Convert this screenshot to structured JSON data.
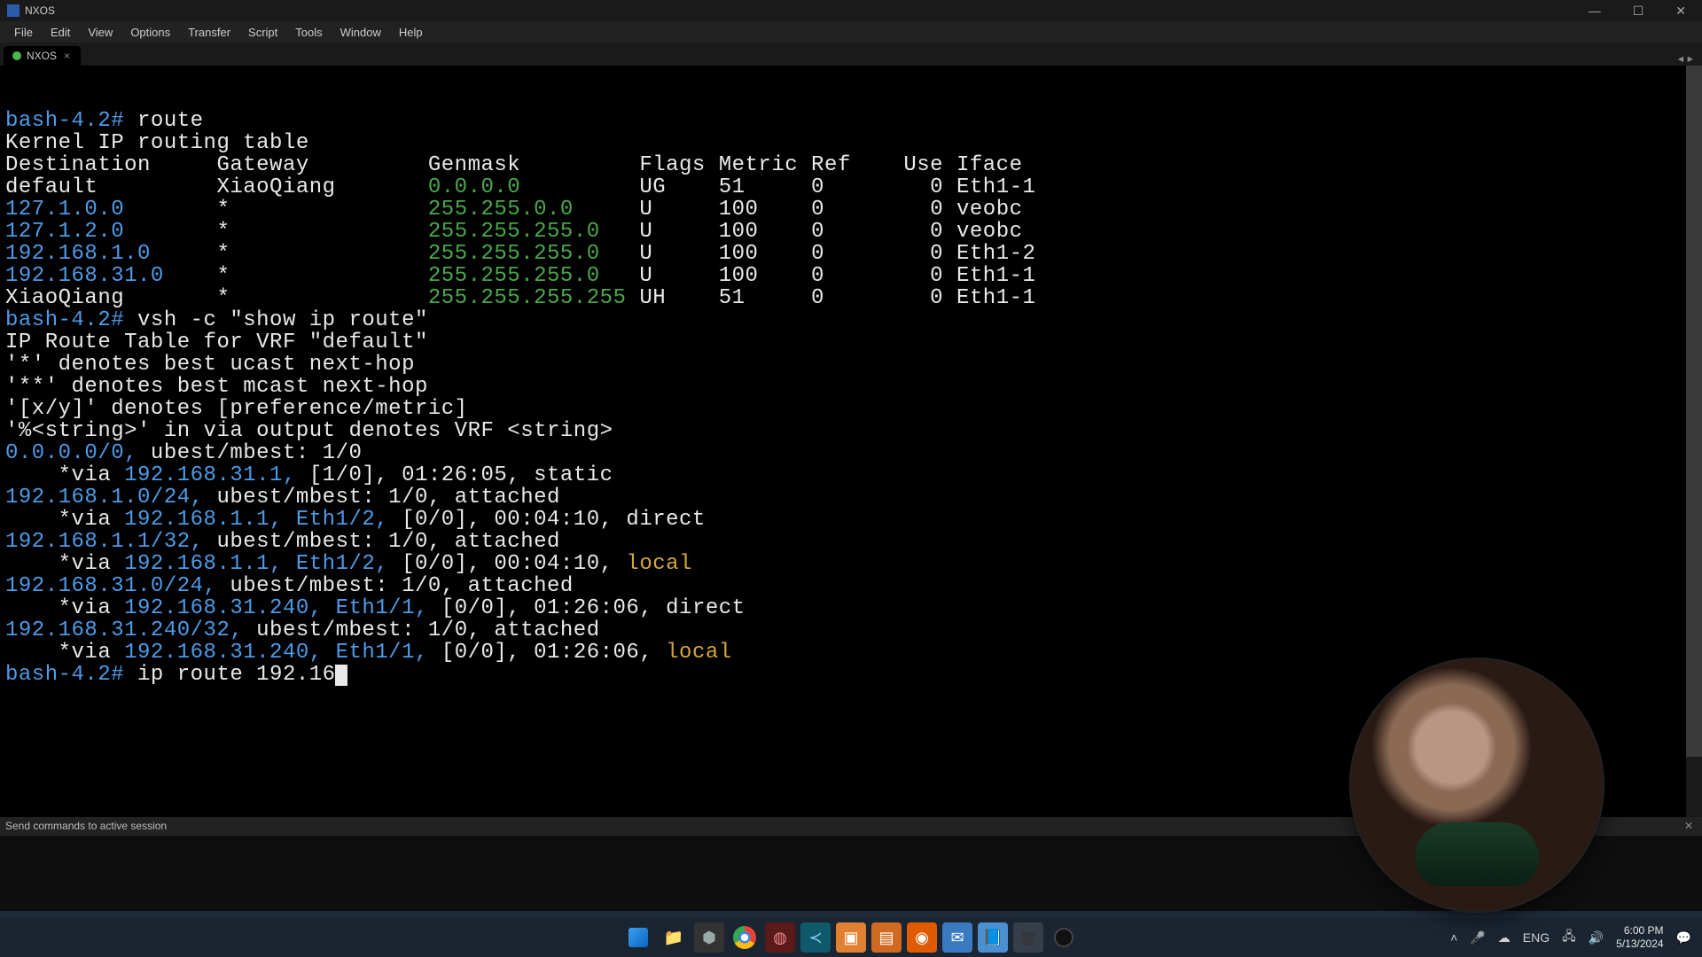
{
  "window": {
    "title": "NXOS"
  },
  "menubar": [
    "File",
    "Edit",
    "View",
    "Options",
    "Transfer",
    "Script",
    "Tools",
    "Window",
    "Help"
  ],
  "tab": {
    "label": "NXOS"
  },
  "status": {
    "text": "Send commands to active session"
  },
  "taskbar": {
    "lang": "ENG",
    "time": "6:00 PM",
    "date": "5/13/2024"
  },
  "terminal": {
    "lines": [
      {
        "segs": [
          {
            "c": "blue",
            "t": "bash-4.2#"
          },
          {
            "c": "white",
            "t": " route"
          }
        ]
      },
      {
        "segs": [
          {
            "c": "white",
            "t": "Kernel IP routing table"
          }
        ]
      },
      {
        "segs": [
          {
            "c": "white",
            "t": "Destination     Gateway         Genmask         Flags Metric Ref    Use Iface"
          }
        ]
      },
      {
        "segs": [
          {
            "c": "white",
            "t": "default         XiaoQiang       "
          },
          {
            "c": "green",
            "t": "0.0.0.0"
          },
          {
            "c": "white",
            "t": "         UG    51     0        0 Eth1-1"
          }
        ]
      },
      {
        "segs": [
          {
            "c": "blue",
            "t": "127.1.0.0"
          },
          {
            "c": "white",
            "t": "       *               "
          },
          {
            "c": "green",
            "t": "255.255.0.0"
          },
          {
            "c": "white",
            "t": "     U     100    0        0 veobc"
          }
        ]
      },
      {
        "segs": [
          {
            "c": "blue",
            "t": "127.1.2.0"
          },
          {
            "c": "white",
            "t": "       *               "
          },
          {
            "c": "green",
            "t": "255.255.255.0"
          },
          {
            "c": "white",
            "t": "   U     100    0        0 veobc"
          }
        ]
      },
      {
        "segs": [
          {
            "c": "blue",
            "t": "192.168.1.0"
          },
          {
            "c": "white",
            "t": "     *               "
          },
          {
            "c": "green",
            "t": "255.255.255.0"
          },
          {
            "c": "white",
            "t": "   U     100    0        0 Eth1-2"
          }
        ]
      },
      {
        "segs": [
          {
            "c": "blue",
            "t": "192.168.31.0"
          },
          {
            "c": "white",
            "t": "    *               "
          },
          {
            "c": "green",
            "t": "255.255.255.0"
          },
          {
            "c": "white",
            "t": "   U     100    0        0 Eth1-1"
          }
        ]
      },
      {
        "segs": [
          {
            "c": "white",
            "t": "XiaoQiang       *               "
          },
          {
            "c": "green",
            "t": "255.255.255.255"
          },
          {
            "c": "white",
            "t": " UH    51     0        0 Eth1-1"
          }
        ]
      },
      {
        "segs": [
          {
            "c": "blue",
            "t": "bash-4.2#"
          },
          {
            "c": "white",
            "t": " vsh -c \"show ip route\""
          }
        ]
      },
      {
        "segs": [
          {
            "c": "white",
            "t": "IP Route Table for VRF \"default\""
          }
        ]
      },
      {
        "segs": [
          {
            "c": "white",
            "t": "'*' denotes best ucast next-hop"
          }
        ]
      },
      {
        "segs": [
          {
            "c": "white",
            "t": "'**' denotes best mcast next-hop"
          }
        ]
      },
      {
        "segs": [
          {
            "c": "white",
            "t": "'[x/y]' denotes [preference/metric]"
          }
        ]
      },
      {
        "segs": [
          {
            "c": "white",
            "t": "'%<string>' in via output denotes VRF <string>"
          }
        ]
      },
      {
        "segs": [
          {
            "c": "white",
            "t": ""
          }
        ]
      },
      {
        "segs": [
          {
            "c": "blue",
            "t": "0.0.0.0/0,"
          },
          {
            "c": "white",
            "t": " ubest/mbest: 1/0"
          }
        ]
      },
      {
        "segs": [
          {
            "c": "white",
            "t": "    *via "
          },
          {
            "c": "blue",
            "t": "192.168.31.1,"
          },
          {
            "c": "white",
            "t": " [1/0], 01:26:05, static"
          }
        ]
      },
      {
        "segs": [
          {
            "c": "blue",
            "t": "192.168.1.0/24,"
          },
          {
            "c": "white",
            "t": " ubest/mbest: 1/0, attached"
          }
        ]
      },
      {
        "segs": [
          {
            "c": "white",
            "t": "    *via "
          },
          {
            "c": "blue",
            "t": "192.168.1.1, Eth1/2,"
          },
          {
            "c": "white",
            "t": " [0/0], 00:04:10, direct"
          }
        ]
      },
      {
        "segs": [
          {
            "c": "blue",
            "t": "192.168.1.1/32,"
          },
          {
            "c": "white",
            "t": " ubest/mbest: 1/0, attached"
          }
        ]
      },
      {
        "segs": [
          {
            "c": "white",
            "t": "    *via "
          },
          {
            "c": "blue",
            "t": "192.168.1.1, Eth1/2,"
          },
          {
            "c": "white",
            "t": " [0/0], 00:04:10, "
          },
          {
            "c": "yellow",
            "t": "local"
          }
        ]
      },
      {
        "segs": [
          {
            "c": "blue",
            "t": "192.168.31.0/24,"
          },
          {
            "c": "white",
            "t": " ubest/mbest: 1/0, attached"
          }
        ]
      },
      {
        "segs": [
          {
            "c": "white",
            "t": "    *via "
          },
          {
            "c": "blue",
            "t": "192.168.31.240, Eth1/1,"
          },
          {
            "c": "white",
            "t": " [0/0], 01:26:06, direct"
          }
        ]
      },
      {
        "segs": [
          {
            "c": "blue",
            "t": "192.168.31.240/32,"
          },
          {
            "c": "white",
            "t": " ubest/mbest: 1/0, attached"
          }
        ]
      },
      {
        "segs": [
          {
            "c": "white",
            "t": "    *via "
          },
          {
            "c": "blue",
            "t": "192.168.31.240, Eth1/1,"
          },
          {
            "c": "white",
            "t": " [0/0], 01:26:06, "
          },
          {
            "c": "yellow",
            "t": "local"
          }
        ]
      },
      {
        "segs": [
          {
            "c": "white",
            "t": ""
          }
        ]
      },
      {
        "segs": [
          {
            "c": "blue",
            "t": "bash-4.2#"
          },
          {
            "c": "white",
            "t": " ip route 192.16"
          }
        ],
        "cursor": true
      }
    ]
  }
}
